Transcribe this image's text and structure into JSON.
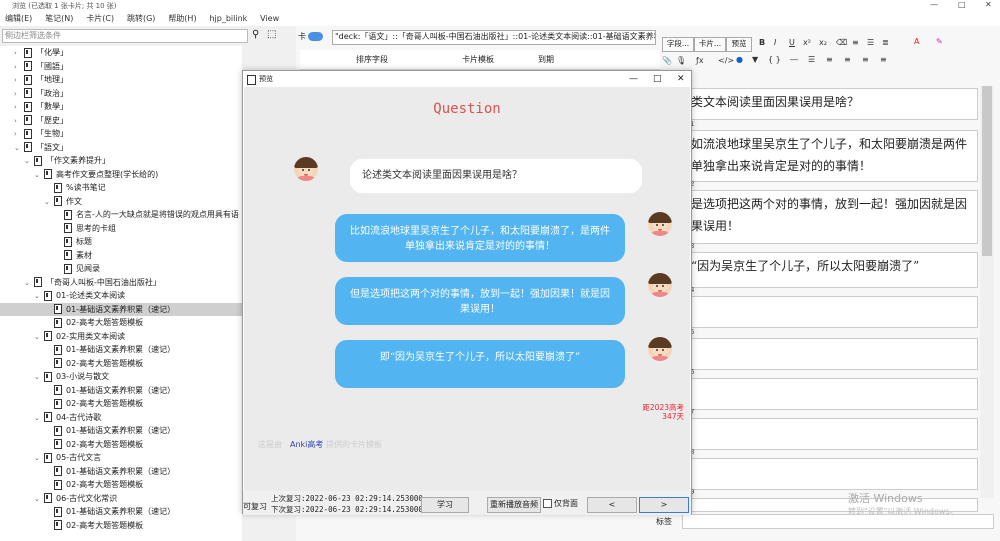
{
  "window": {
    "title": "浏览 (已选取 1 张卡片; 共 10 张)",
    "controls": [
      "—",
      "□",
      "✕"
    ]
  },
  "menu": [
    "编辑(E)",
    "笔记(N)",
    "卡片(C)",
    "跳转(G)",
    "帮助(H)",
    "hjp_bilink",
    "View"
  ],
  "sidebar": {
    "filter_placeholder": "侧边栏筛选条件",
    "tree": [
      {
        "indent": 1,
        "arrow": "›",
        "label": "「化學」"
      },
      {
        "indent": 1,
        "arrow": "›",
        "label": "「國語」"
      },
      {
        "indent": 1,
        "arrow": "›",
        "label": "「地理」"
      },
      {
        "indent": 1,
        "arrow": "›",
        "label": "「政治」"
      },
      {
        "indent": 1,
        "arrow": "›",
        "label": "「數學」"
      },
      {
        "indent": 1,
        "arrow": "›",
        "label": "「歷史」"
      },
      {
        "indent": 1,
        "arrow": "›",
        "label": "「生物」"
      },
      {
        "indent": 1,
        "arrow": "⌄",
        "label": "「語文」"
      },
      {
        "indent": 2,
        "arrow": "⌄",
        "label": "「作文素养提升」"
      },
      {
        "indent": 3,
        "arrow": "⌄",
        "label": "高考作文要点整理(学长给的)"
      },
      {
        "indent": 4,
        "arrow": "",
        "label": "%读书笔记"
      },
      {
        "indent": 4,
        "arrow": "⌄",
        "label": "作文"
      },
      {
        "indent": 5,
        "arrow": "",
        "label": "名言-人的一大缺点就是将错误的观点用具有语"
      },
      {
        "indent": 5,
        "arrow": "",
        "label": "思考的卡组"
      },
      {
        "indent": 5,
        "arrow": "",
        "label": "标题"
      },
      {
        "indent": 5,
        "arrow": "",
        "label": "素材"
      },
      {
        "indent": 5,
        "arrow": "",
        "label": "见闻录"
      },
      {
        "indent": 2,
        "arrow": "⌄",
        "label": "「奇哥人叫板-中国石油出版社」"
      },
      {
        "indent": 3,
        "arrow": "⌄",
        "label": "01-论述类文本阅读"
      },
      {
        "indent": 4,
        "arrow": "",
        "label": "01-基础语文素养积累（速记）",
        "selected": true
      },
      {
        "indent": 4,
        "arrow": "",
        "label": "02-高考大题答题模板"
      },
      {
        "indent": 3,
        "arrow": "⌄",
        "label": "02-实用类文本阅读"
      },
      {
        "indent": 4,
        "arrow": "",
        "label": "01-基础语文素养积累（速记）"
      },
      {
        "indent": 4,
        "arrow": "",
        "label": "02-高考大题答题模板"
      },
      {
        "indent": 3,
        "arrow": "⌄",
        "label": "03-小说与散文"
      },
      {
        "indent": 4,
        "arrow": "",
        "label": "01-基础语文素养积累（速记）"
      },
      {
        "indent": 4,
        "arrow": "",
        "label": "02-高考大题答题模板"
      },
      {
        "indent": 3,
        "arrow": "⌄",
        "label": "04-古代诗歌"
      },
      {
        "indent": 4,
        "arrow": "",
        "label": "01-基础语文素养积累（速记）"
      },
      {
        "indent": 4,
        "arrow": "",
        "label": "02-高考大题答题模板"
      },
      {
        "indent": 3,
        "arrow": "⌄",
        "label": "05-古代文言"
      },
      {
        "indent": 4,
        "arrow": "",
        "label": "01-基础语文素养积累（速记）"
      },
      {
        "indent": 4,
        "arrow": "",
        "label": "02-高考大题答题模板"
      },
      {
        "indent": 3,
        "arrow": "⌄",
        "label": "06-古代文化常识"
      },
      {
        "indent": 4,
        "arrow": "",
        "label": "01-基础语文素养积累（速记）"
      },
      {
        "indent": 4,
        "arrow": "",
        "label": "02-高考大题答题模板"
      }
    ]
  },
  "browser": {
    "toggle_label": "卡",
    "deck_search": "\"deck:「语文」::「奇哥人叫板-中国石油出版社」::01-论述类文本阅读::01-基础语文素养积累（速记）\"",
    "columns": [
      "排序字段",
      "卡片模板",
      "到期"
    ]
  },
  "editor": {
    "buttons": [
      "字段...",
      "卡片...",
      "预览"
    ],
    "format_icons": [
      "B",
      "I",
      "U",
      "x²",
      "x₂",
      "⌫",
      "≡",
      "☰",
      "≣",
      "A",
      "✎"
    ],
    "fields": [
      {
        "num": "",
        "text": "类文本阅读里面因果误用是啥？"
      },
      {
        "num": "1",
        "text": "如流浪地球里吴京生了个儿子，和太阳要崩溃是两件单独拿出来说肯定是对的的事情！"
      },
      {
        "num": "2",
        "text": "是选项把这两个对的事情，放到一起！强加因就是因果误用！"
      },
      {
        "num": "3",
        "text": "“因为吴京生了个儿子，所以太阳要崩溃了”"
      },
      {
        "num": "4",
        "text": ""
      },
      {
        "num": "5",
        "text": ""
      },
      {
        "num": "6",
        "text": ""
      },
      {
        "num": "7",
        "text": ""
      },
      {
        "num": "8",
        "text": ""
      },
      {
        "num": "9",
        "text": ""
      }
    ],
    "tags_label": "标签"
  },
  "watermark": {
    "line1": "激活 Windows",
    "line2": "转到\"设置\"以激活 Windows。"
  },
  "preview": {
    "title": "预览",
    "controls": [
      "—",
      "□",
      "✕"
    ],
    "heading": "Question",
    "question": "论述类文本阅读里面因果误用是啥？",
    "answers": [
      "比如流浪地球里吴京生了个儿子，和太阳要崩溃了，是两件单独拿出来说肯定是对的的事情！",
      "但是选项把这两个对的事情，放到一起！强加因果！就是因果误用！",
      "即“因为吴京生了个儿子，所以太阳要崩溃了”"
    ],
    "countdown_line1": "距2023高考",
    "countdown_line2": "347天",
    "faint_text": "这是由",
    "anki_link": "Anki高考",
    "faint_text2": "提供的卡片模板",
    "bottom": {
      "repeat_label": "可复习",
      "last_review": "上次复习:2022-06-23 02:29:14.253000",
      "next_review": "下次复习:2022-06-23 02:29:14.253000",
      "study_button": "学习",
      "replay_button": "重新播放音频",
      "back_only_label": "仅背面",
      "prev_button": "<",
      "next_button": ">"
    }
  }
}
